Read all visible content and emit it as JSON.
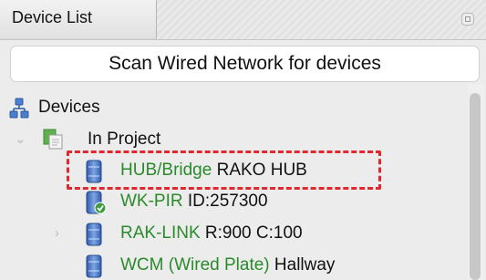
{
  "panel": {
    "tab_title": "Device List"
  },
  "toolbar": {
    "scan_label": "Scan Wired Network for devices"
  },
  "tree": {
    "root": {
      "label": "Devices",
      "icon": "network-icon"
    },
    "group": {
      "label": "In Project",
      "icon": "project-icon",
      "expanded": true
    },
    "items": [
      {
        "type": "HUB/Bridge",
        "name": "RAKO HUB",
        "icon": "device-icon",
        "highlighted": true
      },
      {
        "type": "WK-PIR",
        "name": "ID:257300",
        "icon": "device-check-icon"
      },
      {
        "type": "RAK-LINK",
        "name": "R:900 C:100",
        "icon": "device-icon",
        "expandable": true
      },
      {
        "type": "WCM (Wired Plate)",
        "name": "Hallway",
        "icon": "device-icon"
      }
    ]
  },
  "colors": {
    "type_text": "#2b8a2b",
    "highlight": "#e0282f",
    "device_blue": "#3f6ab8"
  }
}
